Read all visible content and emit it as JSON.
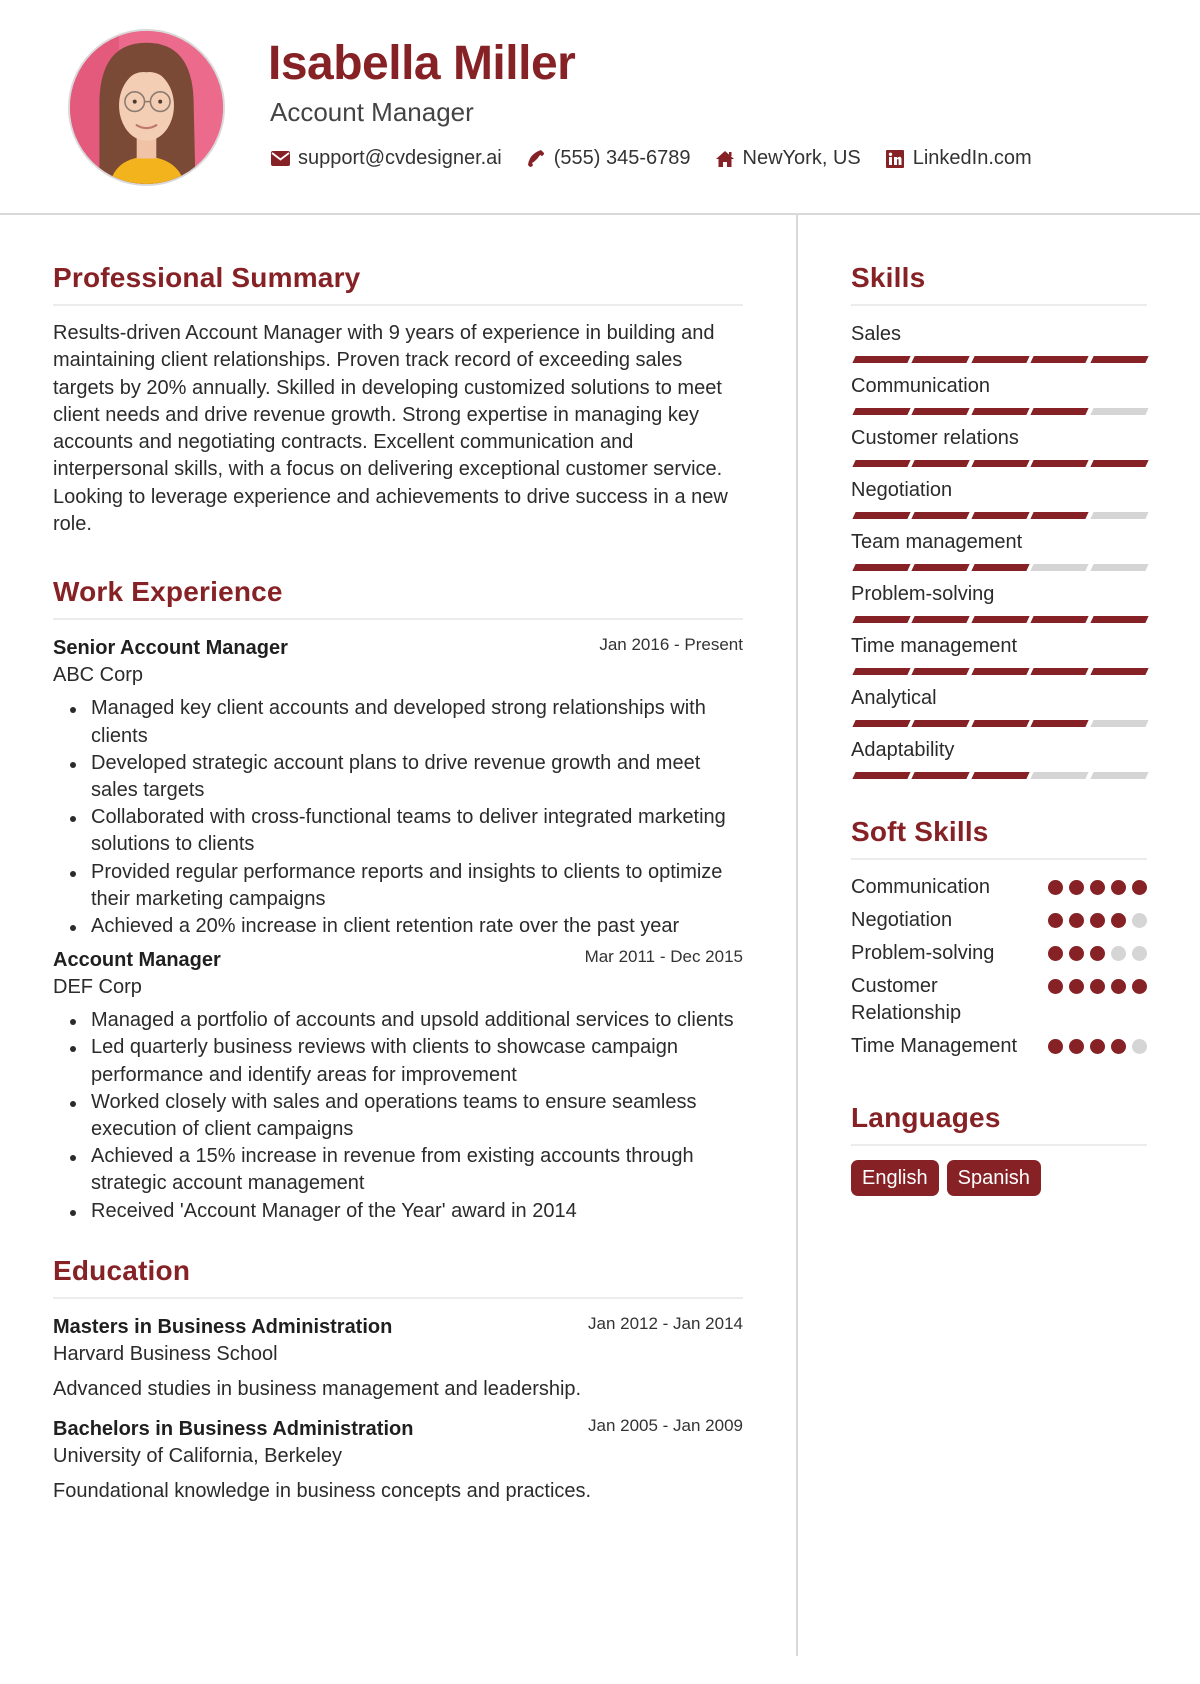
{
  "header": {
    "name": "Isabella Miller",
    "title": "Account Manager",
    "avatar_alt": "profile-photo",
    "contacts": [
      {
        "icon": "envelope-icon",
        "text": "support@cvdesigner.ai"
      },
      {
        "icon": "phone-icon",
        "text": "(555) 345-6789"
      },
      {
        "icon": "home-icon",
        "text": "NewYork, US"
      },
      {
        "icon": "linkedin-icon",
        "text": "LinkedIn.com"
      }
    ]
  },
  "colors": {
    "accent": "#862225",
    "inactive": "#d5d5d5",
    "divider": "#d9d9d9"
  },
  "summary": {
    "title": "Professional Summary",
    "text": "Results-driven Account Manager with 9 years of experience in building and maintaining client relationships. Proven track record of exceeding sales targets by 20% annually. Skilled in developing customized solutions to meet client needs and drive revenue growth. Strong expertise in managing key accounts and negotiating contracts. Excellent communication and interpersonal skills, with a focus on delivering exceptional customer service. Looking to leverage experience and achievements to drive success in a new role."
  },
  "experience": {
    "title": "Work Experience",
    "jobs": [
      {
        "role": "Senior Account Manager",
        "company": "ABC Corp",
        "dates": "Jan 2016 - Present",
        "bullets": [
          "Managed key client accounts and developed strong relationships with clients",
          "Developed strategic account plans to drive revenue growth and meet sales targets",
          "Collaborated with cross-functional teams to deliver integrated marketing solutions to clients",
          "Provided regular performance reports and insights to clients to optimize their marketing campaigns",
          "Achieved a 20% increase in client retention rate over the past year"
        ]
      },
      {
        "role": "Account Manager",
        "company": "DEF Corp",
        "dates": "Mar 2011 - Dec 2015",
        "bullets": [
          "Managed a portfolio of accounts and upsold additional services to clients",
          "Led quarterly business reviews with clients to showcase campaign performance and identify areas for improvement",
          "Worked closely with sales and operations teams to ensure seamless execution of client campaigns",
          "Achieved a 15% increase in revenue from existing accounts through strategic account management",
          "Received 'Account Manager of the Year' award in 2014"
        ]
      }
    ]
  },
  "education": {
    "title": "Education",
    "items": [
      {
        "degree": "Masters in Business Administration",
        "school": "Harvard Business School",
        "dates": "Jan 2012 - Jan 2014",
        "description": "Advanced studies in business management and leadership."
      },
      {
        "degree": "Bachelors in Business Administration",
        "school": "University of California, Berkeley",
        "dates": "Jan 2005 - Jan 2009",
        "description": "Foundational knowledge in business concepts and practices."
      }
    ]
  },
  "skills": {
    "title": "Skills",
    "max": 5,
    "items": [
      {
        "name": "Sales",
        "level": 5
      },
      {
        "name": "Communication",
        "level": 4
      },
      {
        "name": "Customer relations",
        "level": 5
      },
      {
        "name": "Negotiation",
        "level": 4
      },
      {
        "name": "Team management",
        "level": 3
      },
      {
        "name": "Problem-solving",
        "level": 5
      },
      {
        "name": "Time management",
        "level": 5
      },
      {
        "name": "Analytical",
        "level": 4
      },
      {
        "name": "Adaptability",
        "level": 3
      }
    ]
  },
  "soft_skills": {
    "title": "Soft Skills",
    "max": 5,
    "items": [
      {
        "name": "Communication",
        "level": 5
      },
      {
        "name": "Negotiation",
        "level": 4
      },
      {
        "name": "Problem-solving",
        "level": 3
      },
      {
        "name": "Customer Relationship",
        "level": 5
      },
      {
        "name": "Time Management",
        "level": 4
      }
    ]
  },
  "languages": {
    "title": "Languages",
    "items": [
      "English",
      "Spanish"
    ]
  }
}
